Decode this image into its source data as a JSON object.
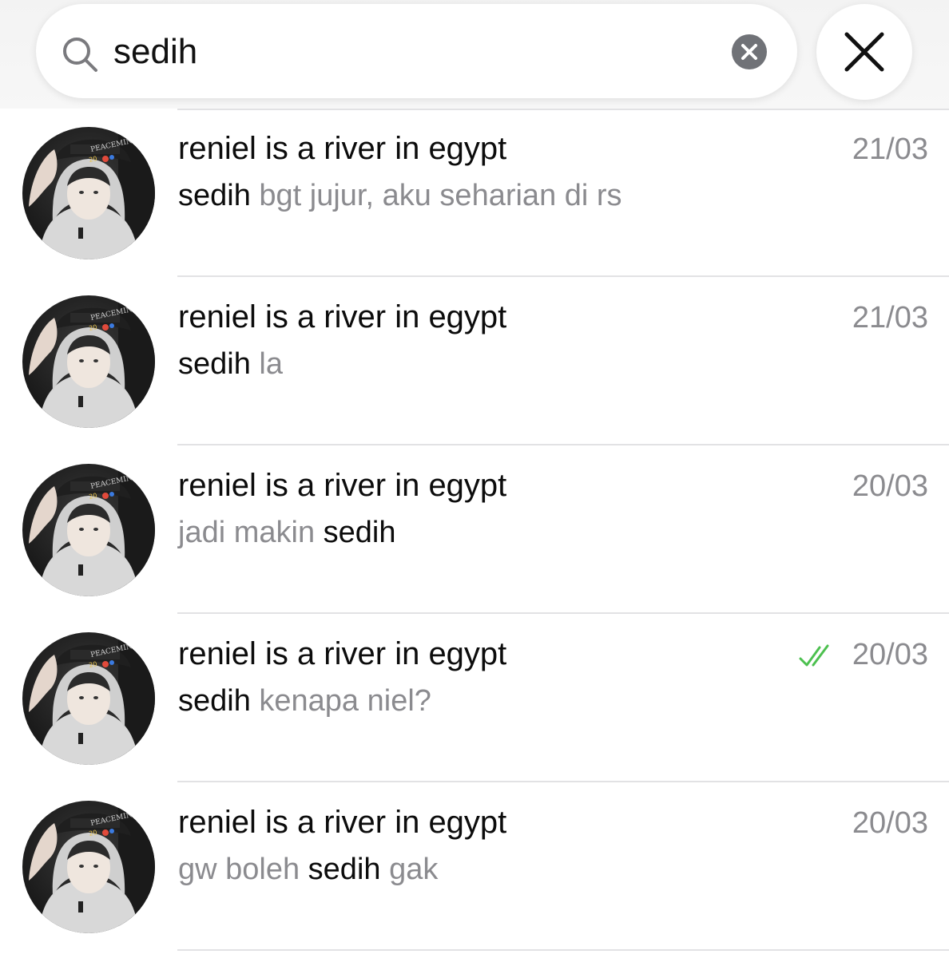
{
  "search": {
    "query": "sedih",
    "search_icon": "search-icon",
    "clear_icon": "clear-x-circle-icon",
    "close_icon": "close-icon"
  },
  "results": [
    {
      "name": "reniel is a river in egypt",
      "date": "21/03",
      "read": false,
      "snippet": [
        {
          "text": "sedih",
          "hl": true
        },
        {
          "text": " bgt jujur, aku seharian di rs",
          "hl": false
        }
      ]
    },
    {
      "name": "reniel is a river in egypt",
      "date": "21/03",
      "read": false,
      "snippet": [
        {
          "text": "sedih",
          "hl": true
        },
        {
          "text": " la",
          "hl": false
        }
      ]
    },
    {
      "name": "reniel is a river in egypt",
      "date": "20/03",
      "read": false,
      "snippet": [
        {
          "text": "jadi makin ",
          "hl": false
        },
        {
          "text": "sedih",
          "hl": true
        }
      ]
    },
    {
      "name": "reniel is a river in egypt",
      "date": "20/03",
      "read": true,
      "snippet": [
        {
          "text": "sedih",
          "hl": true
        },
        {
          "text": " kenapa niel?",
          "hl": false
        }
      ]
    },
    {
      "name": "reniel is a river in egypt",
      "date": "20/03",
      "read": false,
      "snippet": [
        {
          "text": "gw boleh ",
          "hl": false
        },
        {
          "text": "sedih",
          "hl": true
        },
        {
          "text": " gak",
          "hl": false
        }
      ]
    }
  ],
  "colors": {
    "read_check": "#4cc04f",
    "muted_text": "#8b8b8f",
    "highlight_text": "#0c0c0c"
  }
}
